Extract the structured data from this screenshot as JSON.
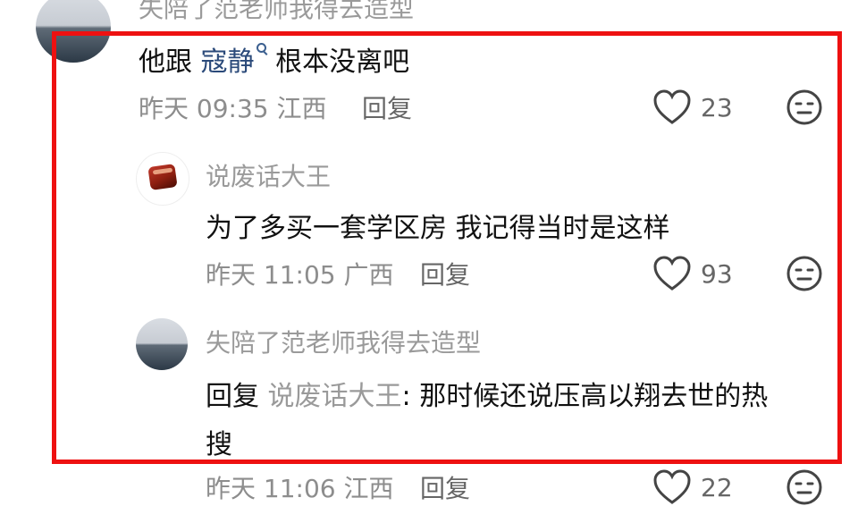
{
  "comments": [
    {
      "author": "失陪了范老师我得去造型",
      "text_before": "他跟 ",
      "mention": "寇静",
      "text_after": " 根本没离吧",
      "time": "昨天 09:35 江西",
      "reply_label": "回复",
      "likes": "23",
      "avatar_icon": "seascape-avatar-icon"
    },
    {
      "author": "说废话大王",
      "text": "为了多买一套学区房 我记得当时是这样",
      "time": "昨天 11:05 广西",
      "reply_label": "回复",
      "likes": "93",
      "avatar_icon": "braised-pork-avatar-icon"
    },
    {
      "author": "失陪了范老师我得去造型",
      "reply_prefix": "回复 ",
      "reply_to": "说废话大王",
      "text_line1": ": 那时候还说压高以翔去世的热",
      "text_line2": "搜",
      "time": "昨天 11:06 江西",
      "reply_label": "回复",
      "likes": "22",
      "avatar_icon": "seascape-avatar-icon"
    }
  ],
  "colors": {
    "highlight": "#ee1111",
    "mention": "#2b4a7a",
    "name": "#9a9a9a"
  }
}
